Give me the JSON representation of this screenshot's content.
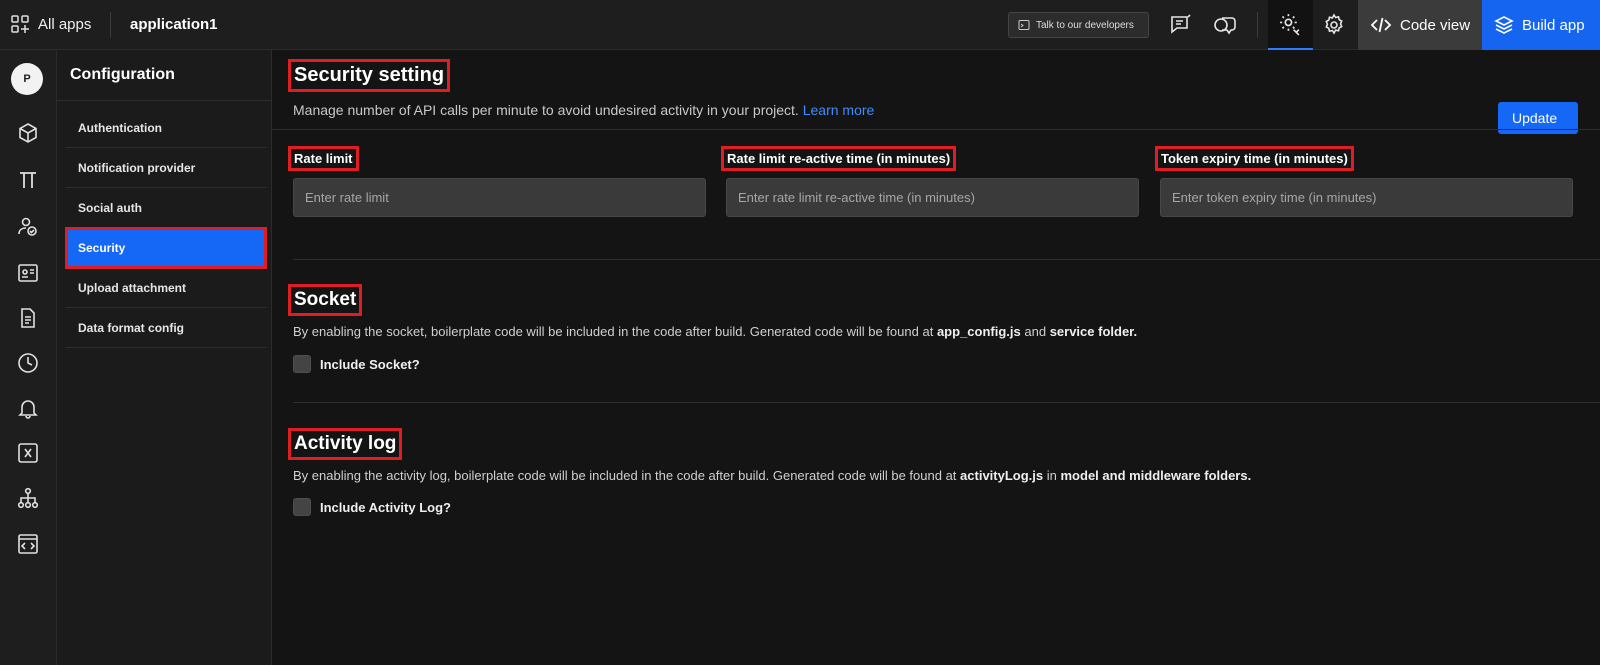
{
  "topbar": {
    "all_apps": "All apps",
    "app_name": "application1",
    "talk_button": "Talk to our developers",
    "code_view": "Code view",
    "build_app": "Build app"
  },
  "rail": {
    "avatar_initial": "P",
    "icons": [
      "cube-icon",
      "pi-icon",
      "users-icon",
      "id-card-icon",
      "document-icon",
      "clock-icon",
      "bell-icon",
      "variable-icon",
      "hierarchy-icon",
      "code-window-icon"
    ]
  },
  "config": {
    "title": "Configuration",
    "items": [
      {
        "label": "Authentication"
      },
      {
        "label": "Notification provider"
      },
      {
        "label": "Social auth"
      },
      {
        "label": "Security"
      },
      {
        "label": "Upload attachment"
      },
      {
        "label": "Data format config"
      }
    ],
    "active_index": 3
  },
  "security": {
    "title": "Security setting",
    "description": "Manage number of API calls per minute to avoid undesired activity in your project.",
    "learn_more": "Learn more",
    "update_button": "Update",
    "fields": [
      {
        "label": "Rate limit",
        "placeholder": "Enter rate limit",
        "value": ""
      },
      {
        "label": "Rate limit re-active time (in minutes)",
        "placeholder": "Enter rate limit re-active time (in minutes)",
        "value": ""
      },
      {
        "label": "Token expiry time (in minutes)",
        "placeholder": "Enter token expiry time (in minutes)",
        "value": ""
      }
    ]
  },
  "socket": {
    "title": "Socket",
    "desc_prefix": "By enabling the socket, boilerplate code will be included in the code after build. Generated code will be found at",
    "desc_file": "app_config.js",
    "desc_and": "and",
    "desc_folder": "service folder.",
    "checkbox_label": "Include Socket?",
    "checked": false
  },
  "activity_log": {
    "title": "Activity log",
    "desc_prefix": "By enabling the activity log, boilerplate code will be included in the code after build. Generated code will be found at",
    "desc_file": "activityLog.js",
    "desc_in": "in",
    "desc_folder": "model and middleware folders.",
    "checkbox_label": "Include Activity Log?",
    "checked": false
  },
  "colors": {
    "accent": "#1468f5",
    "highlight": "#e01c24",
    "background": "#141414"
  }
}
